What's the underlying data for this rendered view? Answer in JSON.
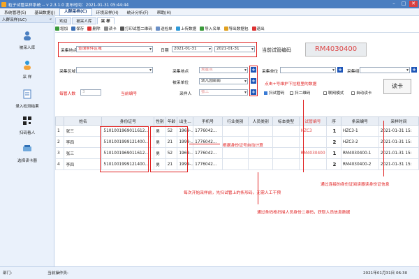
{
  "window": {
    "title": "粒子试管采样系统 -- v 2.3.1.0    发布时间：2021-01-31 05:44:44"
  },
  "menu": [
    "系统管理(S)",
    "基础数据(J)",
    "人群采样(C)",
    "环境采样(H)",
    "统计分析(F)",
    "帮助(H)"
  ],
  "left_panel": {
    "header": "人群采样(&C)",
    "items": [
      {
        "label": "被采人库",
        "icon": "person-group-icon"
      },
      {
        "label": "采 样",
        "icon": "person-sample-icon"
      },
      {
        "label": "录入检测结果",
        "icon": "document-edit-icon"
      },
      {
        "label": "扫码看人",
        "icon": "qrcode-icon"
      },
      {
        "label": "选择读卡器",
        "icon": "card-reader-icon"
      }
    ]
  },
  "tabs": [
    "欢迎",
    "被采人库",
    "采 样"
  ],
  "toolbar": [
    "增加",
    "保存",
    "删除",
    "读卡",
    "打印试管二维码",
    "送检单",
    "上传数据",
    "导入名单",
    "导出数据包",
    "退出"
  ],
  "form": {
    "sample_location_label": "采集地点",
    "sample_location_value": "查询条件区域",
    "date_label": "日期",
    "date_from": "2021-01-31",
    "date_to": "2021-01-31",
    "current_tube_label": "当前试管编码",
    "current_tube_code": "RM4030400",
    "region_label": "采集区域",
    "site_label": "采集地点",
    "site_value": "观星点",
    "unit_label": "被采单位",
    "unit_value": "幼儿园南南",
    "collector_label": "采样人",
    "collector_value": "张三",
    "person_unit_label": "采集单位",
    "group_label": "采集组",
    "per_tube_label": "每管人数",
    "per_tube_value": "3",
    "current_no_label": "当前编号",
    "plus_note": "点击+号维护下拉框里的数据",
    "scan_tube": "扫试管码",
    "scan_2d": "扫二维码",
    "link_mode": "联网模式",
    "auto_read": "自动读卡",
    "read_card_button": "读卡"
  },
  "table": {
    "columns": [
      "",
      "姓名",
      "身份证号",
      "性别",
      "年龄",
      "出生...",
      "手机号",
      "行业类别",
      "人员类别",
      "标本类型",
      "试管编号",
      "序",
      "条采编号",
      "采样时间"
    ],
    "rows": [
      {
        "idx": "1",
        "name": "张三",
        "id": "5101001969011612...",
        "sex": "男",
        "age": "52",
        "birth": "1969-...",
        "phone": "1776042...",
        "tube": "HZC3",
        "seq": "1",
        "code": "HZC3-1",
        "time": "2021-01-31 15:"
      },
      {
        "idx": "2",
        "name": "李四",
        "id": "5101001999121400...",
        "sex": "男",
        "age": "21",
        "birth": "1999-...",
        "phone": "1776042...",
        "tube": "",
        "seq": "2",
        "code": "HZC3-2",
        "time": "2021-01-31 15:"
      },
      {
        "idx": "3",
        "name": "张三",
        "id": "5101001969011612...",
        "sex": "男",
        "age": "52",
        "birth": "1969-...",
        "phone": "1776042...",
        "tube": "RM4030400",
        "seq": "1",
        "code": "RM4030400-1",
        "time": "2021-01-31 15:"
      },
      {
        "idx": "4",
        "name": "李四",
        "id": "5101001999121400...",
        "sex": "男",
        "age": "21",
        "birth": "1999-...",
        "phone": "1776042...",
        "tube": "",
        "seq": "2",
        "code": "RM4030400-2",
        "time": "2021-01-31 15:"
      }
    ]
  },
  "annotations": {
    "age_note": "根据身份证号自动计算",
    "scan_before_note": "每次开始采样前，先扫试管上的条形码，无需人工干预",
    "scan_qr_note": "通过条码枪扫描人员身份二维码，获取人员信息数据",
    "id_read_note": "通过连接的身份证阅读器读身份证信息"
  },
  "status": {
    "dept_label": "部门:",
    "operator_label": "当前操作员:",
    "datetime": "2021年01月31日 06:30"
  },
  "colors": {
    "accent": "#4a7ec0",
    "annotation_red": "#e02020",
    "tube_code": "#d44"
  }
}
